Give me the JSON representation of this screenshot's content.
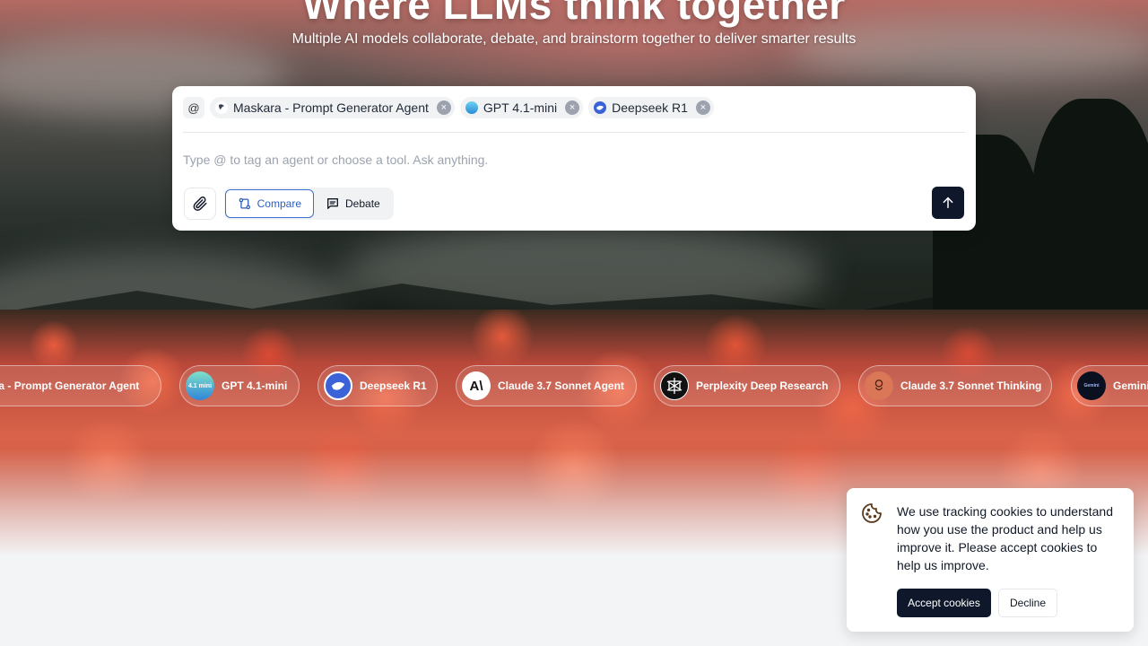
{
  "hero": {
    "headline": "Where LLMs think together",
    "subtitle": "Multiple AI models collaborate, debate, and brainstorm together to deliver smarter results"
  },
  "composer": {
    "at_symbol": "@",
    "tags": [
      {
        "label": "Maskara - Prompt Generator Agent",
        "icon": "maskara-logo-icon"
      },
      {
        "label": "GPT 4.1-mini",
        "icon": "gpt-logo-icon"
      },
      {
        "label": "Deepseek R1",
        "icon": "deepseek-logo-icon"
      }
    ],
    "input_value": "",
    "input_placeholder": "Type @ to tag an agent or choose a tool. Ask anything.",
    "modes": [
      {
        "label": "Compare",
        "icon": "compare-icon",
        "active": true
      },
      {
        "label": "Debate",
        "icon": "chat-bubble-icon",
        "active": false
      }
    ],
    "attach_icon": "paperclip-icon",
    "send_icon": "arrow-up-icon"
  },
  "agents": [
    {
      "label": "Maskara - Prompt Generator Agent",
      "icon": "maskara-logo-icon"
    },
    {
      "label": "GPT 4.1-mini",
      "icon": "gpt-logo-icon",
      "logo_text": "4.1 mini"
    },
    {
      "label": "Deepseek R1",
      "icon": "deepseek-logo-icon"
    },
    {
      "label": "Claude 3.7 Sonnet Agent",
      "icon": "anthropic-logo-icon",
      "logo_text": "A\\"
    },
    {
      "label": "Perplexity Deep Research",
      "icon": "perplexity-logo-icon"
    },
    {
      "label": "Claude 3.7 Sonnet Thinking",
      "icon": "claude-thinking-logo-icon"
    },
    {
      "label": "Gemini",
      "icon": "gemini-logo-icon",
      "logo_text": "Gemini"
    }
  ],
  "cookie_banner": {
    "text": "We use tracking cookies to understand how you use the product and help us improve it. Please accept cookies to help us improve.",
    "accept_label": "Accept cookies",
    "decline_label": "Decline",
    "icon": "cookie-icon"
  },
  "colors": {
    "accent_blue": "#3b6fd1",
    "dark_button": "#0f172a",
    "page_background": "#f3f4f6"
  }
}
